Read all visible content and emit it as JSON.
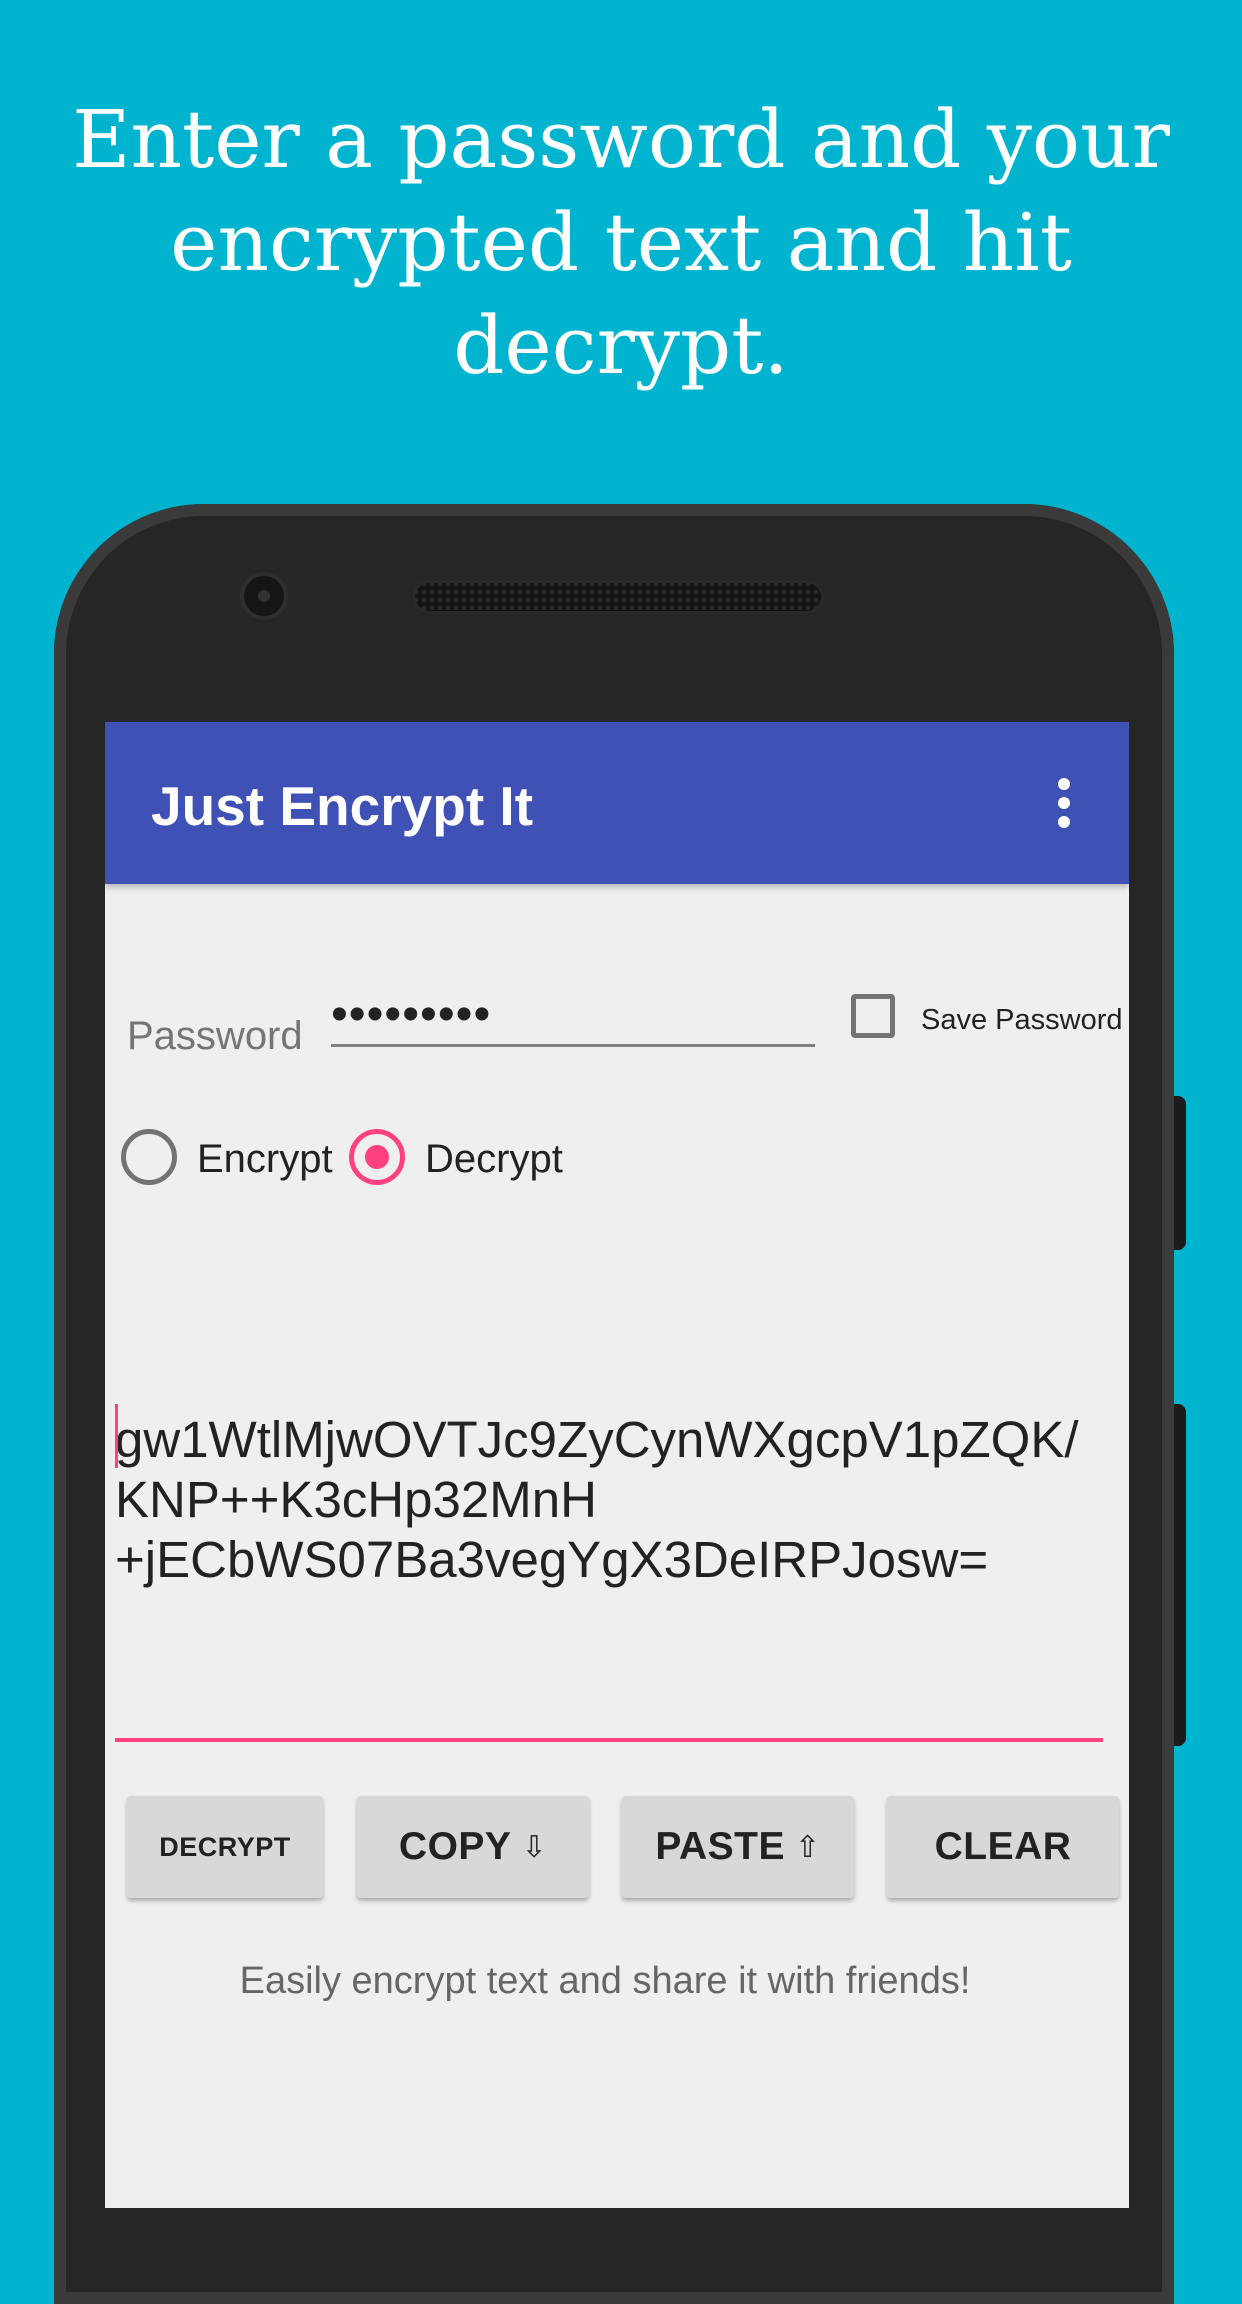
{
  "headline": {
    "line1": "Enter a password and your",
    "line2": "encrypted text and hit",
    "line3": "decrypt."
  },
  "app": {
    "title": "Just Encrypt It"
  },
  "password": {
    "label": "Password",
    "value": "•••••••••",
    "save_label": "Save Password",
    "save_checked": false
  },
  "mode": {
    "encrypt_label": "Encrypt",
    "decrypt_label": "Decrypt",
    "selected": "Decrypt"
  },
  "cipher_text": {
    "line1": "gw1WtlMjwOVTJc9ZyCynWXgcpV1pZQK/",
    "line2": "KNP++K3cHp32MnH",
    "line3": "+jECbWS07Ba3vegYgX3DeIRPJosw="
  },
  "buttons": {
    "decrypt": "DECRYPT",
    "copy": "COPY",
    "copy_icon": "⇩",
    "paste": "PASTE",
    "paste_icon": "⇧",
    "clear": "CLEAR"
  },
  "tagline": "Easily encrypt text and share it with friends!",
  "colors": {
    "background": "#00b4d0",
    "app_bar": "#3f51b5",
    "accent": "#ff4081",
    "screen": "#efefef"
  },
  "icons": {
    "menu": "overflow-menu-icon",
    "copy": "arrow-down-icon",
    "paste": "arrow-up-icon"
  }
}
